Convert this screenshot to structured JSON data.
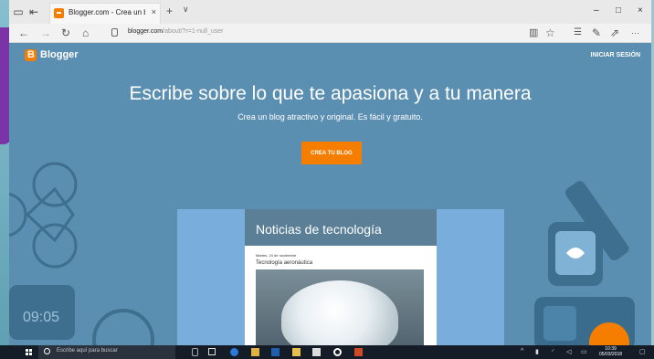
{
  "browser": {
    "tab_title": "Blogger.com - Crea un bl",
    "tab_close": "×",
    "new_tab": "+",
    "tab_dropdown": "∨",
    "win_minimize": "–",
    "win_maximize": "□",
    "win_close": "×",
    "nav_back": "←",
    "nav_forward": "→",
    "nav_refresh": "↻",
    "nav_home": "⌂",
    "url_host": "blogger.com",
    "url_rest": "/about/?r=1-null_user",
    "reading_view": "▥",
    "favorite": "☆",
    "favorites_hub": "☰",
    "pen": "✎",
    "share": "⇗",
    "more": "···"
  },
  "page": {
    "brand": "Blogger",
    "signin": "INICIAR SESIÓN",
    "headline": "Escribe sobre lo que te apasiona y a tu manera",
    "subheadline": "Crea un blog atractivo y original. Es fácil y gratuito.",
    "cta": "CREA TU BLOG"
  },
  "post": {
    "blog_title": "Noticias de tecnología",
    "date": "Martes, 24 de noviembre",
    "post_title": "Tecnología aeronáutica"
  },
  "taskbar": {
    "search_placeholder": "Escribe aquí para buscar",
    "time": "10:39",
    "date": "05/03/2018"
  },
  "colors": {
    "page_bg": "#5b8fb2",
    "accent": "#f57d00"
  }
}
